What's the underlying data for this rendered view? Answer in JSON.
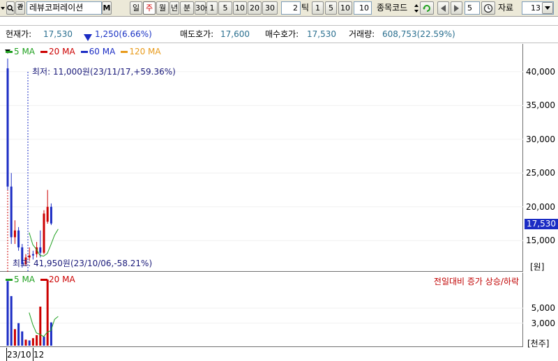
{
  "toolbar": {
    "stock_name": "레뷰코퍼레이션",
    "m_label": "M",
    "periods": [
      {
        "label": "일",
        "active": false
      },
      {
        "label": "주",
        "active": true
      },
      {
        "label": "월",
        "active": false
      },
      {
        "label": "년",
        "active": false
      },
      {
        "label": "분",
        "active": false
      },
      {
        "label": "30s",
        "active": false
      },
      {
        "label": "1",
        "active": false
      },
      {
        "label": "5",
        "active": false
      },
      {
        "label": "10",
        "active": false
      },
      {
        "label": "20",
        "active": false
      },
      {
        "label": "30",
        "active": false
      }
    ],
    "tick_value": "2",
    "tick_label": "틱",
    "tick_buttons": [
      "1",
      "5",
      "10"
    ],
    "tick_field": "10",
    "stock_code_label": "종목코드",
    "step_value": "5",
    "data_label": "자료",
    "data_count": "13"
  },
  "info": {
    "current_label": "현재가:",
    "current_value": "17,530",
    "change_icon": "down-triangle",
    "change_value": "1,250(6.66%)",
    "ask_label": "매도호가:",
    "ask_value": "17,600",
    "bid_label": "매수호가:",
    "bid_value": "17,530",
    "volume_label": "거래량:",
    "volume_value": "608,753(22.59%)"
  },
  "colors": {
    "up": "#cc0000",
    "down": "#1b2cc4",
    "ma5": "#1fa01f",
    "ma20": "#cc0000",
    "ma60": "#1b2cc4",
    "ma120": "#e89a1a"
  },
  "price_legend": [
    {
      "label": "5 MA",
      "color": "#1fa01f"
    },
    {
      "label": "20 MA",
      "color": "#cc0000"
    },
    {
      "label": "60 MA",
      "color": "#1b2cc4"
    },
    {
      "label": "120 MA",
      "color": "#e89a1a"
    }
  ],
  "volume_legend": [
    {
      "label": "5 MA",
      "color": "#1fa01f"
    },
    {
      "label": "20 MA",
      "color": "#cc0000"
    }
  ],
  "annotations": {
    "low": "최저: 11,000원(23/11/17,+59.36%)",
    "high": "최고: 41,950원(23/10/06,-58.21%)",
    "volume_note": "전일대비 증가 상승/하락"
  },
  "current_price_tag": "17,530",
  "units": {
    "price": "[원]",
    "volume": "[천주]"
  },
  "chart_data": {
    "type": "candlestick",
    "price_axis": {
      "ticks": [
        15000,
        20000,
        25000,
        30000,
        35000,
        40000
      ],
      "labels": [
        "15,000",
        "20,000",
        "25,000",
        "30,000",
        "35,000",
        "40,000"
      ],
      "range": [
        11000,
        43500
      ]
    },
    "volume_axis": {
      "ticks": [
        3000,
        5000
      ],
      "labels": [
        "3,000",
        "5,000"
      ],
      "range": [
        0,
        9000
      ]
    },
    "x_labels": [
      "23/10",
      "12"
    ],
    "candles": [
      {
        "open": 40500,
        "high": 41950,
        "low": 22500,
        "close": 23000,
        "dir": "down"
      },
      {
        "open": 23000,
        "high": 25000,
        "low": 14500,
        "close": 15500,
        "dir": "down"
      },
      {
        "open": 15500,
        "high": 18000,
        "low": 14500,
        "close": 16500,
        "dir": "up"
      },
      {
        "open": 16500,
        "high": 17000,
        "low": 13500,
        "close": 14000,
        "dir": "down"
      },
      {
        "open": 14000,
        "high": 14500,
        "low": 11000,
        "close": 11500,
        "dir": "down"
      },
      {
        "open": 11500,
        "high": 13000,
        "low": 11200,
        "close": 12500,
        "dir": "up"
      },
      {
        "open": 12500,
        "high": 14000,
        "low": 12000,
        "close": 12800,
        "dir": "up"
      },
      {
        "open": 12800,
        "high": 13500,
        "low": 12200,
        "close": 13000,
        "dir": "down"
      },
      {
        "open": 13000,
        "high": 14800,
        "low": 12500,
        "close": 14000,
        "dir": "up"
      },
      {
        "open": 14000,
        "high": 16500,
        "low": 12500,
        "close": 13200,
        "dir": "down"
      },
      {
        "open": 13200,
        "high": 19500,
        "low": 13000,
        "close": 19000,
        "dir": "up"
      },
      {
        "open": 17800,
        "high": 22500,
        "low": 17500,
        "close": 20000,
        "dir": "up"
      },
      {
        "open": 20000,
        "high": 20500,
        "low": 17300,
        "close": 17530,
        "dir": "down"
      }
    ],
    "ma5": [
      null,
      null,
      null,
      null,
      16200,
      14400,
      13700,
      12800,
      12700,
      13100,
      14400,
      15800,
      16700
    ],
    "ma20": [
      null,
      null,
      null,
      null,
      null,
      null,
      null,
      null,
      null,
      null,
      null,
      null,
      null
    ],
    "volumes": [
      {
        "value": 8600,
        "dir": "down"
      },
      {
        "value": 6600,
        "dir": "down"
      },
      {
        "value": 2200,
        "dir": "up"
      },
      {
        "value": 3000,
        "dir": "down"
      },
      {
        "value": 1900,
        "dir": "down"
      },
      {
        "value": 800,
        "dir": "up"
      },
      {
        "value": 700,
        "dir": "down"
      },
      {
        "value": 1000,
        "dir": "up"
      },
      {
        "value": 1400,
        "dir": "up"
      },
      {
        "value": 5200,
        "dir": "up"
      },
      {
        "value": 1200,
        "dir": "down"
      },
      {
        "value": 8800,
        "dir": "up"
      },
      {
        "value": 3100,
        "dir": "down"
      }
    ],
    "vol_ma5": [
      null,
      null,
      null,
      null,
      4400,
      2800,
      1700,
      1500,
      1200,
      1800,
      2000,
      3500,
      3900
    ]
  }
}
